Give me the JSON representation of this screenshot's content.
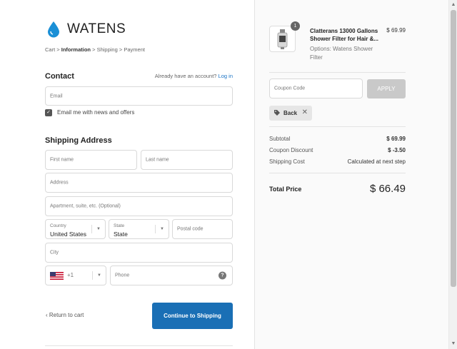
{
  "brand": {
    "name": "WATENS",
    "accent": "#1a6fb5",
    "logo_icon": "water-drop-icon"
  },
  "breadcrumb": {
    "cart": "Cart",
    "sep": ">",
    "information": "Information",
    "shipping": "Shipping",
    "payment": "Payment"
  },
  "contact": {
    "title": "Contact",
    "have_account": "Already have an account?",
    "login": "Log in",
    "email_placeholder": "Email",
    "newsletter_label": "Email me with news and offers",
    "newsletter_checked": true
  },
  "shipping": {
    "title": "Shipping Address",
    "first_name": "First name",
    "last_name": "Last name",
    "address": "Address",
    "apartment": "Apartment, suite, etc. (Optional)",
    "country_label": "Country",
    "country_value": "United States",
    "state_label": "State",
    "state_value": "State",
    "postal": "Postal code",
    "city": "City",
    "dial_code": "+1",
    "phone": "Phone"
  },
  "actions": {
    "return_to_cart": "Return to cart",
    "continue": "Continue to Shipping"
  },
  "summary": {
    "item": {
      "quantity": "1",
      "name": "Clatterans 13000 Gallons Shower Filter for Hair &...",
      "price": "$ 69.99",
      "options": "Options: Watens Shower Filter"
    },
    "coupon_placeholder": "Coupon Code",
    "apply": "APPLY",
    "applied_tag": "Back",
    "subtotal_label": "Subtotal",
    "subtotal": "$ 69.99",
    "discount_label": "Coupon Discount",
    "discount": "$ -3.50",
    "shipping_label": "Shipping Cost",
    "shipping": "Calculated at next step",
    "total_label": "Total Price",
    "total": "$ 66.49"
  }
}
